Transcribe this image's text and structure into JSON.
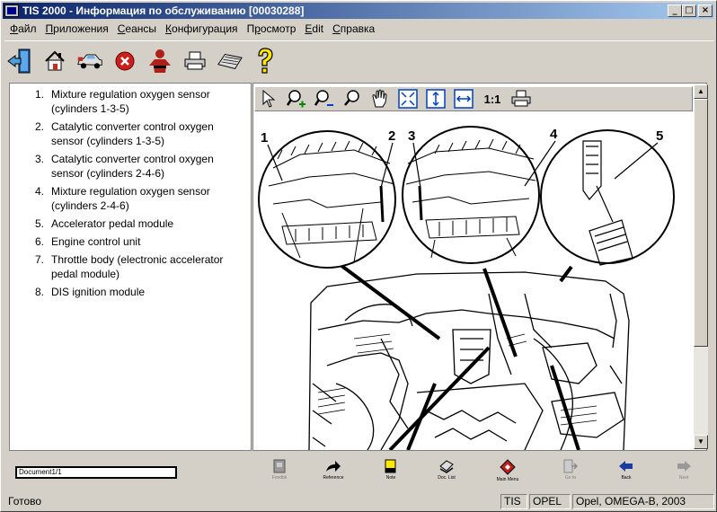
{
  "window": {
    "title": "TIS 2000 - Информация по обслуживанию [00030288]"
  },
  "menu": [
    {
      "label": "Файл",
      "u": "Ф"
    },
    {
      "label": "Приложения",
      "u": "П"
    },
    {
      "label": "Сеансы",
      "u": "С"
    },
    {
      "label": "Конфигурация",
      "u": "К"
    },
    {
      "label": "Просмотр",
      "u": "р"
    },
    {
      "label": "Edit",
      "u": "E"
    },
    {
      "label": "Справка",
      "u": "С"
    }
  ],
  "toolbar_icons": [
    "exit-door-icon",
    "home-icon",
    "vehicle-icon",
    "stop-icon",
    "person-icon",
    "print-icon",
    "keyboard-icon",
    "help-icon"
  ],
  "legend": [
    {
      "num": "1.",
      "text": "Mixture regulation oxygen sensor (cylinders 1-3-5)"
    },
    {
      "num": "2.",
      "text": "Catalytic converter control oxygen sensor (cylinders 1-3-5)"
    },
    {
      "num": "3.",
      "text": "Catalytic converter control oxygen sensor (cylinders 2-4-6)"
    },
    {
      "num": "4.",
      "text": "Mixture regulation oxygen sensor (cylinders 2-4-6)"
    },
    {
      "num": "5.",
      "text": "Accelerator pedal module"
    },
    {
      "num": "6.",
      "text": "Engine control unit"
    },
    {
      "num": "7.",
      "text": "Throttle body (electronic accelerator pedal module)"
    },
    {
      "num": "8.",
      "text": "DIS ignition module"
    }
  ],
  "image_toolbar": {
    "zoom_actual": "1:1"
  },
  "diagram_labels": [
    "1",
    "2",
    "3",
    "4",
    "5"
  ],
  "doc_field": "Document1/1",
  "nav": [
    {
      "label": "Feedbk",
      "disabled": true
    },
    {
      "label": "Reference",
      "disabled": false
    },
    {
      "label": "Note",
      "disabled": false
    },
    {
      "label": "Doc. List",
      "disabled": false
    },
    {
      "label": "Main Menu",
      "disabled": false
    },
    {
      "label": "Go to",
      "disabled": true
    },
    {
      "label": "Back",
      "disabled": false
    },
    {
      "label": "Next",
      "disabled": true
    }
  ],
  "status": {
    "ready": "Готово",
    "app": "TIS",
    "brand": "OPEL",
    "vehicle": "Opel, OMEGA-B, 2003"
  }
}
